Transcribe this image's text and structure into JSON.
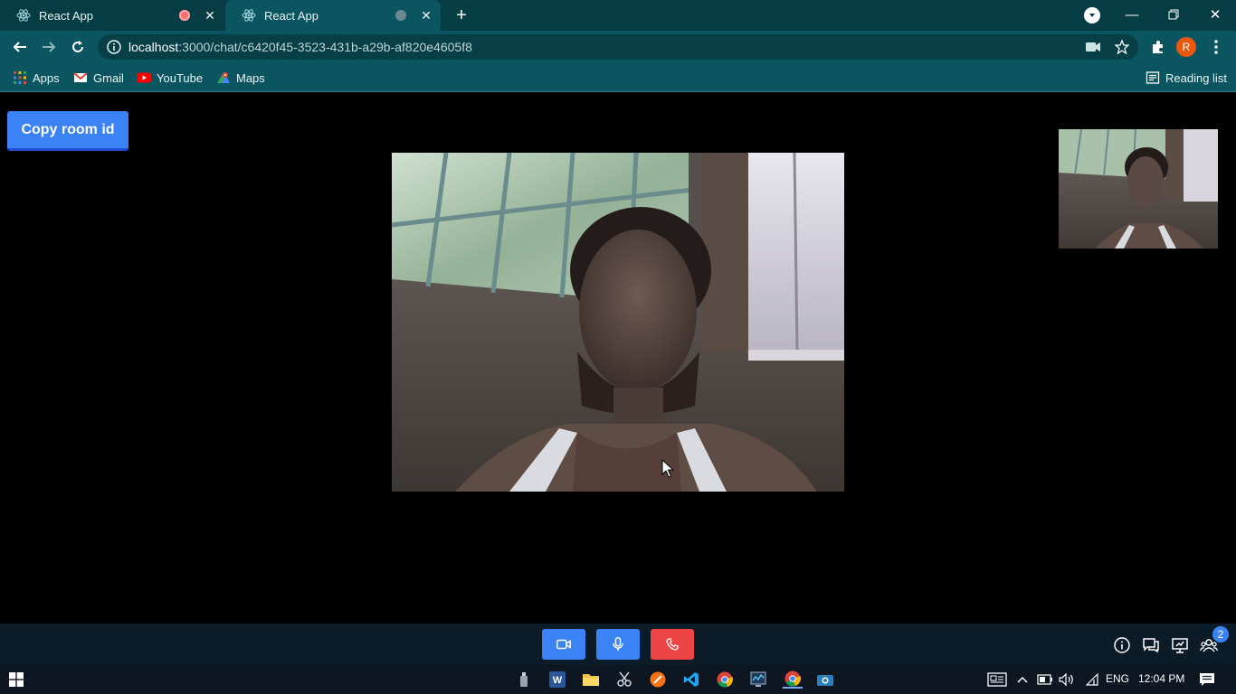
{
  "browser": {
    "tabs": [
      {
        "title": "React App",
        "recording": true
      },
      {
        "title": "React App",
        "recording": false,
        "active": true
      }
    ],
    "url_host": "localhost",
    "url_path": ":3000/chat/c6420f45-3523-431b-a29b-af820e4605f8",
    "profile_initial": "R",
    "bookmarks": [
      {
        "label": "Apps",
        "icon": "apps-grid-icon"
      },
      {
        "label": "Gmail",
        "icon": "gmail-icon"
      },
      {
        "label": "YouTube",
        "icon": "youtube-icon"
      },
      {
        "label": "Maps",
        "icon": "maps-icon"
      }
    ],
    "reading_list": "Reading list"
  },
  "page": {
    "copy_button": "Copy room id"
  },
  "callbar": {
    "participants_count": "2"
  },
  "taskbar": {
    "language": "ENG",
    "time": "12:04 PM"
  },
  "colors": {
    "chrome_dark": "#063d45",
    "chrome_main": "#0b5560",
    "primary_button": "#3b82f6",
    "end_call": "#ef4444",
    "callbar_bg": "#0c1b28"
  }
}
